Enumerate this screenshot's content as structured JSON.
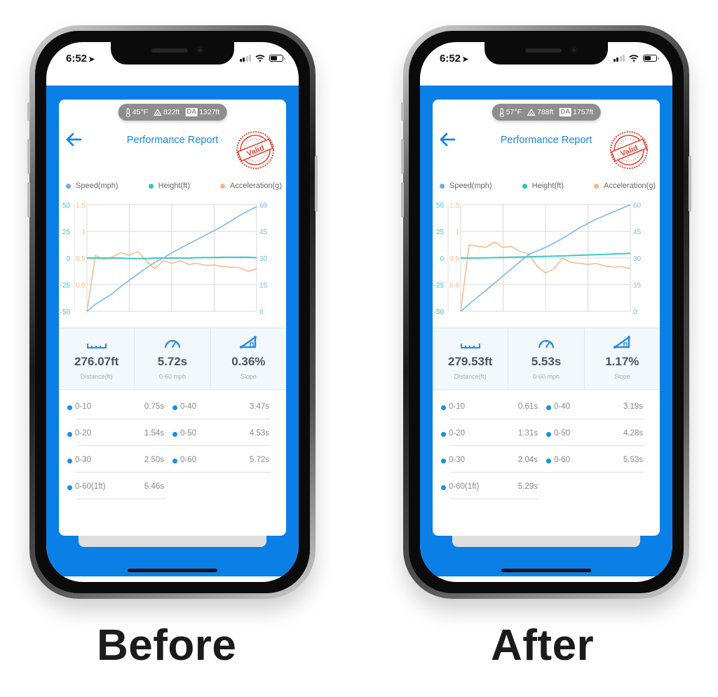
{
  "captions": {
    "before": "Before",
    "after": "After"
  },
  "colors": {
    "accent": "#0a7fe6",
    "title": "#1a86e0",
    "speed": "#7ab8ec",
    "height": "#3cc9c4",
    "acceleration": "#f7bd8c",
    "stamp": "#e2483b"
  },
  "panels": [
    {
      "id": "before",
      "status": {
        "time": "6:52",
        "location_icon": "location-arrow-icon",
        "icons": [
          "signal-icon",
          "wifi-icon",
          "battery-icon"
        ]
      },
      "env": {
        "temperature": "45°F",
        "altitude": "822ft",
        "da_label": "DA",
        "density_altitude": "1327ft"
      },
      "header": {
        "back_icon": "arrow-left-icon",
        "title": "Performance Report",
        "stamp_text": "Valid"
      },
      "legend": [
        {
          "label": "Speed(mph)",
          "color": "#6aaee8"
        },
        {
          "label": "Height(ft)",
          "color": "#32c3bd"
        },
        {
          "label": "Acceleration(g)",
          "color": "#f7b585"
        }
      ],
      "stats": [
        {
          "icon": "ruler-icon",
          "value": "276.07ft",
          "label": "Distance(ft)"
        },
        {
          "icon": "speedometer-icon",
          "value": "5.72s",
          "label": "0-60 mph"
        },
        {
          "icon": "slope-icon",
          "value": "0.36%",
          "label": "Slope"
        }
      ],
      "splits": [
        {
          "name": "0-10",
          "time": "0.75s"
        },
        {
          "name": "0-40",
          "time": "3.47s"
        },
        {
          "name": "0-20",
          "time": "1.54s"
        },
        {
          "name": "0-50",
          "time": "4.53s"
        },
        {
          "name": "0-30",
          "time": "2.50s"
        },
        {
          "name": "0-60",
          "time": "5.72s"
        },
        {
          "name": "0-60(1ft)",
          "time": "5.46s"
        }
      ]
    },
    {
      "id": "after",
      "status": {
        "time": "6:52",
        "location_icon": "location-arrow-icon",
        "icons": [
          "signal-icon",
          "wifi-icon",
          "battery-icon"
        ]
      },
      "env": {
        "temperature": "57°F",
        "altitude": "788ft",
        "da_label": "DA",
        "density_altitude": "1757ft"
      },
      "header": {
        "back_icon": "arrow-left-icon",
        "title": "Performance Report",
        "stamp_text": "Valid"
      },
      "legend": [
        {
          "label": "Speed(mph)",
          "color": "#6aaee8"
        },
        {
          "label": "Height(ft)",
          "color": "#32c3bd"
        },
        {
          "label": "Acceleration(g)",
          "color": "#f7b585"
        }
      ],
      "stats": [
        {
          "icon": "ruler-icon",
          "value": "279.53ft",
          "label": "Distance(ft)"
        },
        {
          "icon": "speedometer-icon",
          "value": "5.53s",
          "label": "0-60 mph"
        },
        {
          "icon": "slope-icon",
          "value": "1.17%",
          "label": "Slope"
        }
      ],
      "splits": [
        {
          "name": "0-10",
          "time": "0.61s"
        },
        {
          "name": "0-40",
          "time": "3.19s"
        },
        {
          "name": "0-20",
          "time": "1.31s"
        },
        {
          "name": "0-50",
          "time": "4.28s"
        },
        {
          "name": "0-30",
          "time": "2.04s"
        },
        {
          "name": "0-60",
          "time": "5.53s"
        },
        {
          "name": "0-60(1ft)",
          "time": "5.29s"
        }
      ]
    }
  ],
  "chart_data": [
    {
      "type": "line",
      "panel": "before",
      "title": "",
      "grid": true,
      "legend_position": "top",
      "axes": {
        "height_left": {
          "ticks": [
            "50",
            "25",
            "0",
            "-25",
            "-50"
          ],
          "range": [
            -50,
            50
          ],
          "color": "#3cc9c4"
        },
        "acceleration_left": {
          "ticks": [
            "1.5",
            "1",
            "0.5",
            "0.0"
          ],
          "range": [
            -0.5,
            1.5
          ],
          "color": "#f7bd8c"
        },
        "speed_right": {
          "ticks": [
            "60",
            "45",
            "30",
            "15",
            "0"
          ],
          "range": [
            0,
            60
          ],
          "color": "#7ab8ec"
        }
      },
      "x": [
        0,
        0.05,
        0.1,
        0.15,
        0.2,
        0.25,
        0.3,
        0.35,
        0.4,
        0.45,
        0.5,
        0.55,
        0.6,
        0.65,
        0.7,
        0.75,
        0.8,
        0.85,
        0.9,
        0.95,
        1.0
      ],
      "series": [
        {
          "name": "Speed(mph)",
          "axis": "speed_right",
          "values": [
            0,
            4,
            7,
            10,
            14,
            17.5,
            21,
            24.5,
            27.5,
            30,
            33,
            35.5,
            38,
            40.5,
            43,
            45.5,
            48,
            51,
            54,
            56.5,
            59
          ]
        },
        {
          "name": "Height(ft)",
          "axis": "height_left",
          "values": [
            0,
            0,
            0,
            0,
            0,
            -0.5,
            -0.5,
            -0.5,
            0,
            0,
            0,
            0,
            0,
            0.3,
            0.5,
            0.5,
            0.7,
            0.7,
            0.7,
            0.7,
            0.3
          ]
        },
        {
          "name": "Acceleration(g)",
          "axis": "acceleration_left",
          "values": [
            -0.5,
            0.55,
            0.47,
            0.52,
            0.6,
            0.55,
            0.62,
            0.45,
            0.3,
            0.45,
            0.4,
            0.45,
            0.38,
            0.4,
            0.36,
            0.37,
            0.34,
            0.33,
            0.32,
            0.25,
            0.3
          ]
        }
      ]
    },
    {
      "type": "line",
      "panel": "after",
      "title": "",
      "grid": true,
      "legend_position": "top",
      "axes": {
        "height_left": {
          "ticks": [
            "50",
            "25",
            "0",
            "-25",
            "-50"
          ],
          "range": [
            -50,
            50
          ],
          "color": "#3cc9c4"
        },
        "acceleration_left": {
          "ticks": [
            "1.5",
            "1",
            "0.5",
            "0.0"
          ],
          "range": [
            -0.5,
            1.5
          ],
          "color": "#f7bd8c"
        },
        "speed_right": {
          "ticks": [
            "60",
            "45",
            "30",
            "15",
            "0"
          ],
          "range": [
            0,
            60
          ],
          "color": "#7ab8ec"
        }
      },
      "x": [
        0,
        0.05,
        0.1,
        0.15,
        0.2,
        0.25,
        0.3,
        0.35,
        0.4,
        0.45,
        0.5,
        0.55,
        0.6,
        0.65,
        0.7,
        0.75,
        0.8,
        0.85,
        0.9,
        0.95,
        1.0
      ],
      "series": [
        {
          "name": "Speed(mph)",
          "axis": "speed_right",
          "values": [
            0,
            4,
            8,
            12,
            16,
            20,
            24,
            28,
            32,
            34,
            36,
            38.5,
            41,
            44,
            47,
            49.5,
            52,
            54,
            56,
            58,
            60
          ]
        },
        {
          "name": "Height(ft)",
          "axis": "height_left",
          "values": [
            0,
            0,
            0,
            0.2,
            0.4,
            0.6,
            0.8,
            1.0,
            1.2,
            1.4,
            1.6,
            1.8,
            2.0,
            2.3,
            2.6,
            2.9,
            3.2,
            3.5,
            3.8,
            4.1,
            4.4
          ]
        },
        {
          "name": "Acceleration(g)",
          "axis": "acceleration_left",
          "values": [
            -0.5,
            0.75,
            0.72,
            0.7,
            0.8,
            0.7,
            0.72,
            0.62,
            0.58,
            0.35,
            0.22,
            0.3,
            0.5,
            0.42,
            0.4,
            0.38,
            0.4,
            0.35,
            0.33,
            0.34,
            0.3
          ]
        }
      ]
    }
  ]
}
